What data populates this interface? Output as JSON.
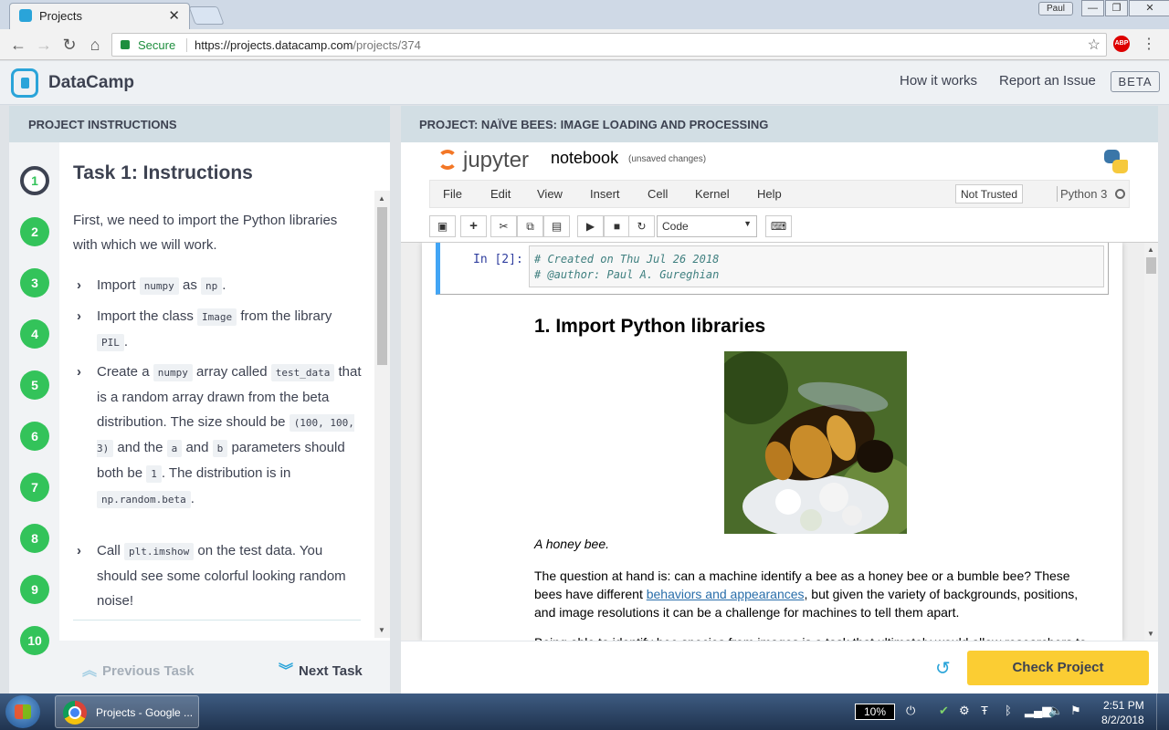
{
  "browser": {
    "tab_title": "Projects",
    "tab_close": "✕",
    "user": "Paul",
    "secure_label": "Secure",
    "url_host": "https://projects.datacamp.com",
    "url_path": "/projects/374",
    "abp": "ABP"
  },
  "header": {
    "brand": "DataCamp",
    "how_it_works": "How it works",
    "report_issue": "Report an Issue",
    "beta": "BETA"
  },
  "instructions": {
    "panel_title": "PROJECT INSTRUCTIONS",
    "steps": [
      "1",
      "2",
      "3",
      "4",
      "5",
      "6",
      "7",
      "8",
      "9",
      "10"
    ],
    "active_step": 1,
    "task_title": "Task 1: Instructions",
    "intro": "First, we need to import the Python libraries with which we will work.",
    "b1": {
      "t1": "Import",
      "c1": "numpy",
      "t2": "as",
      "c2": "np",
      "t3": "."
    },
    "b2": {
      "t1": "Import the class",
      "c1": "Image",
      "t2": "from the library",
      "c2": "PIL",
      "t3": "."
    },
    "b3": {
      "t1": "Create a",
      "c1": "numpy",
      "t2": "array called",
      "c2": "test_data",
      "t3": "that is a random array drawn from the beta distribution. The size should be",
      "c3": "(100, 100, 3)",
      "t4": "and the",
      "c4": "a",
      "t5": "and",
      "c5": "b",
      "t6": "parameters should both be",
      "c6": "1",
      "t7": ". The distribution is in",
      "c7": "np.random.beta",
      "t8": "."
    },
    "b4": {
      "t1": "Call",
      "c1": "plt.imshow",
      "t2": "on the test data. You should see some colorful looking random noise!"
    },
    "prev_task": "Previous Task",
    "next_task": "Next Task"
  },
  "project": {
    "panel_title": "PROJECT: NAÏVE BEES: IMAGE LOADING AND PROCESSING",
    "jupyter": {
      "logo_text": "jupyter",
      "notebook": "notebook",
      "unsaved": "(unsaved changes)",
      "menus": [
        "File",
        "Edit",
        "View",
        "Insert",
        "Cell",
        "Kernel",
        "Help"
      ],
      "trusted": "Not Trusted",
      "kernel": "Python 3",
      "cell_type": "Code"
    },
    "cell": {
      "prompt": "In [2]:",
      "line1": "# Created on Thu Jul 26 2018",
      "line2": "# @author: Paul A. Gureghian"
    },
    "markdown": {
      "heading": "1. Import Python libraries",
      "caption": "A honey bee.",
      "p1_before": "The question at hand is: can a machine identify a bee as a honey bee or a bumble bee? These bees have different ",
      "p1_link": "behaviors and appearances",
      "p1_after": ", but given the variety of backgrounds, positions, and image resolutions it can be a challenge for machines to tell them apart.",
      "p2": "Being able to identify bee species from images is a task that ultimately would allow researchers to"
    },
    "check_button": "Check Project"
  },
  "taskbar": {
    "app_label": "Projects - Google ...",
    "battery": "10%",
    "time": "2:51 PM",
    "date": "8/2/2018"
  }
}
